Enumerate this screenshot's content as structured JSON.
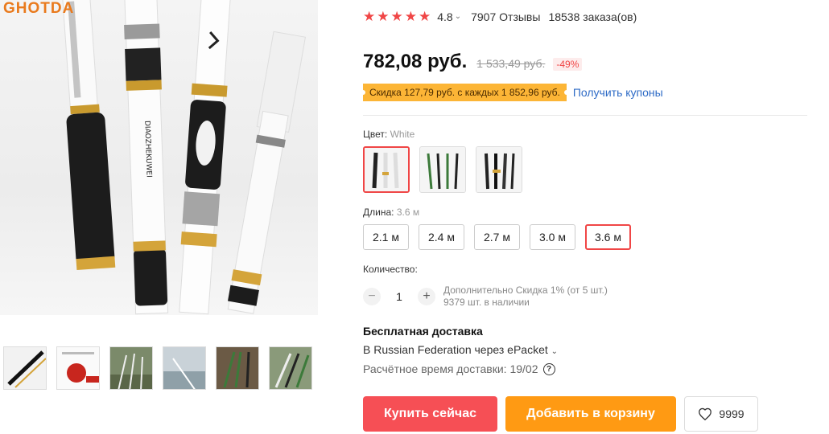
{
  "brand": {
    "logo_text": "GHOTDA"
  },
  "gallery": {
    "main_image": "fishing-rod-white-main",
    "thumbnails": [
      "rod-sections",
      "spiral-wound-carbon",
      "rods-field",
      "rod-by-water",
      "rods-green",
      "rods-outdoor"
    ]
  },
  "rating": {
    "value": "4.8",
    "reviews": "7907 Отзывы",
    "orders": "18538 заказа(ов)",
    "star_color": "#f04646"
  },
  "price": {
    "current": "782,08 руб.",
    "old": "1 533,49 руб.",
    "discount": "-49%"
  },
  "coupon": {
    "tag": "Скидка 127,79 руб. с каждых 1 852,96 руб.",
    "link": "Получить купоны"
  },
  "color": {
    "label": "Цвет: ",
    "selected": "White",
    "options": [
      "White",
      "Green",
      "Black"
    ]
  },
  "length": {
    "label": "Длина: ",
    "selected": "3.6 м",
    "options": [
      "2.1 м",
      "2.4 м",
      "2.7 м",
      "3.0 м",
      "3.6 м"
    ]
  },
  "quantity": {
    "label": "Количество:",
    "value": "1",
    "minus": "−",
    "plus": "+",
    "note_line1": "Дополнительно Скидка 1% (от 5 шт.)",
    "note_line2": "9379 шт. в наличии"
  },
  "shipping": {
    "title": "Бесплатная доставка",
    "destination": "В Russian Federation через ePacket",
    "delivery_time": "Расчётное время доставки: 19/02"
  },
  "actions": {
    "buy_label": "Купить сейчас",
    "cart_label": "Добавить в корзину",
    "wishlist_count": "9999"
  },
  "colors": {
    "accent_red": "#f64f55",
    "cart_orange": "#ff9a13",
    "coupon_yellow": "#fcb536",
    "link_blue": "#2e6bc6"
  }
}
